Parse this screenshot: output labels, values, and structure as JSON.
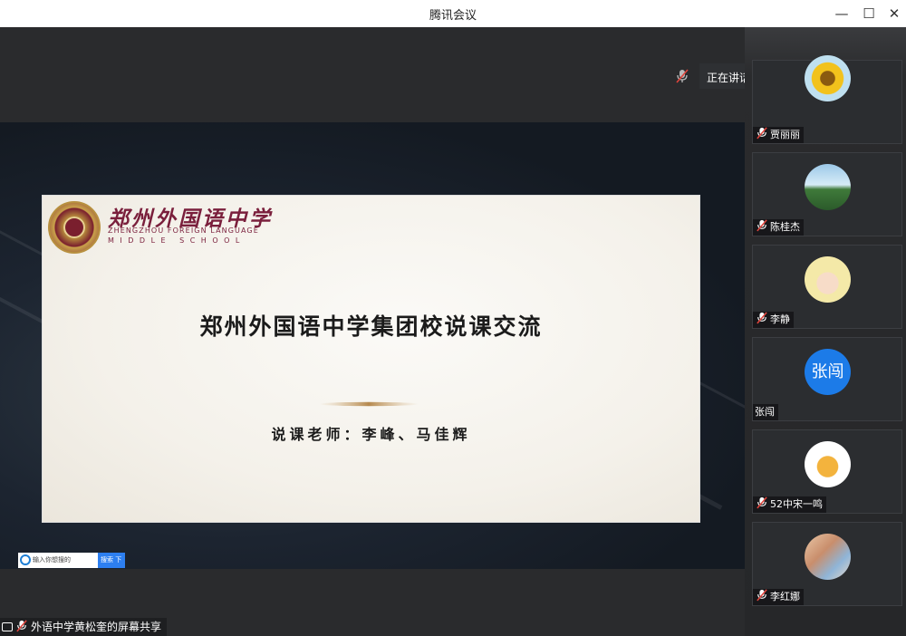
{
  "window": {
    "title": "腾讯会议",
    "minimize": "—",
    "maximize": "☐",
    "close": "✕"
  },
  "speaking": {
    "label": "正在讲话:"
  },
  "slide": {
    "school_cn": "郑州外国语中学",
    "school_en_1": "ZHENGZHOU FOREIGN LANGUAGE",
    "school_en_2": "MIDDLE SCHOOL",
    "title": "郑州外国语中学集团校说课交流",
    "subtitle": "说课老师：李峰、马佳辉"
  },
  "taskbar_search": {
    "placeholder": "输入你想搜的",
    "button": "搜索 下"
  },
  "participants": [
    {
      "name": "贾丽丽",
      "avatar": "sunflower-avatar",
      "muted": true
    },
    {
      "name": "陈桂杰",
      "avatar": "tree-avatar",
      "muted": true
    },
    {
      "name": "李静",
      "avatar": "baby-avatar",
      "muted": true
    },
    {
      "name": "张闯",
      "avatar_text": "张闯",
      "muted": false
    },
    {
      "name": "52中宋一鸣",
      "avatar": "cartoon-avatar",
      "muted": true
    },
    {
      "name": "李红娜",
      "avatar": "kids-avatar",
      "muted": true
    }
  ],
  "share_status": {
    "label": "外语中学黄松奎的屏幕共享"
  },
  "colors": {
    "accent": "#1c7be8",
    "mute_red": "#e0443c",
    "school_maroon": "#7a1f3c"
  }
}
